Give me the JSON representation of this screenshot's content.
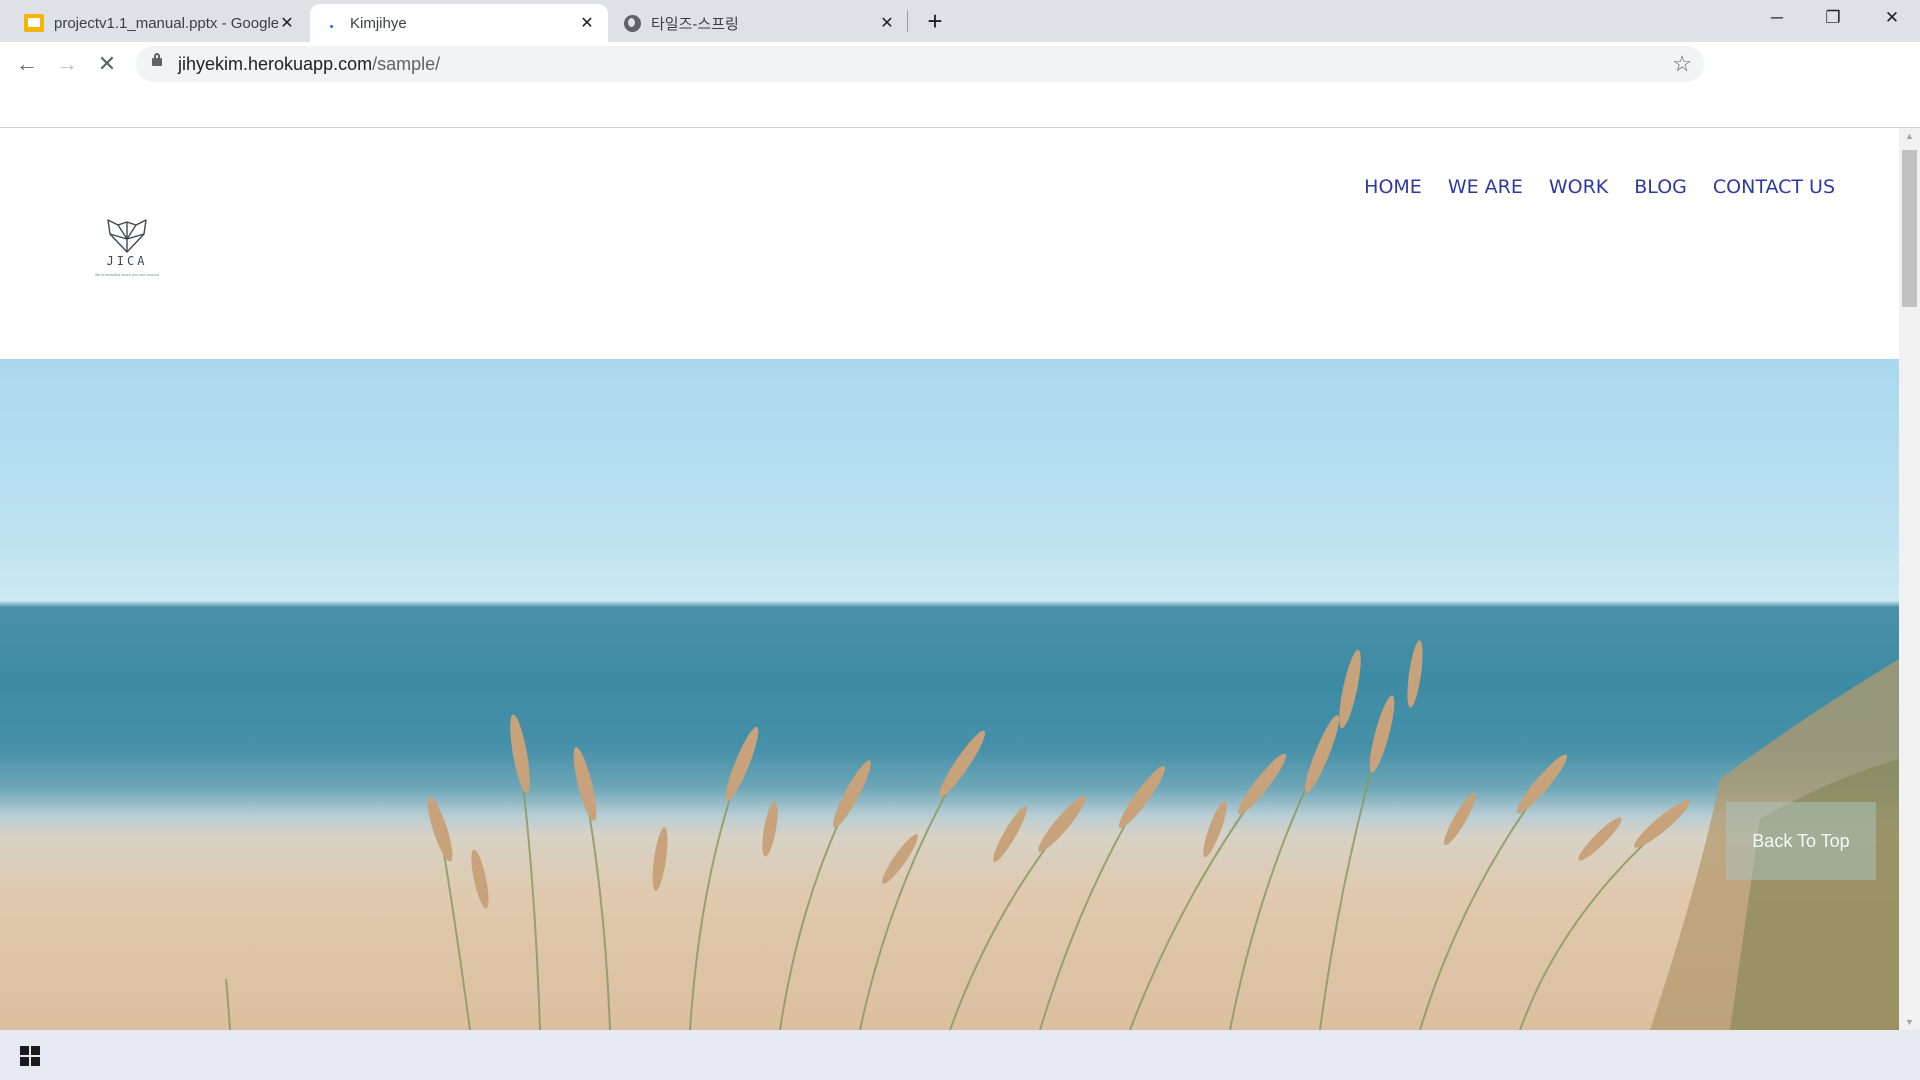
{
  "browser": {
    "tabs": [
      {
        "title": "projectv1.1_manual.pptx - Google Slides",
        "favicon": "google-slides-icon",
        "active": false
      },
      {
        "title": "Kimjihye",
        "favicon": "loading-icon",
        "active": true
      },
      {
        "title": "타일즈-스프링",
        "favicon": "globe-icon",
        "active": false
      }
    ],
    "new_tab_label": "+",
    "url_host": "jihyekim.herokuapp.com",
    "url_path": "/sample/",
    "window_controls": {
      "minimize": "─",
      "restore": "❐",
      "close": "✕"
    },
    "toolbar_icons": {
      "back": "←",
      "forward": "→",
      "reload_stop": "✕",
      "bookmark": "☆"
    }
  },
  "site": {
    "logo_word": "JICA",
    "logo_tagline": "life is beautiful when you are around",
    "nav": [
      "HOME",
      "WE ARE",
      "WORK",
      "BLOG",
      "CONTACT US"
    ],
    "back_to_top_label": "Back To Top"
  },
  "colors": {
    "nav_text": "#2e3aa2",
    "sky": "#b4def0",
    "sea": "#3d8ca3",
    "sand": "#dbbf9f",
    "grass": "#c8a27a"
  }
}
